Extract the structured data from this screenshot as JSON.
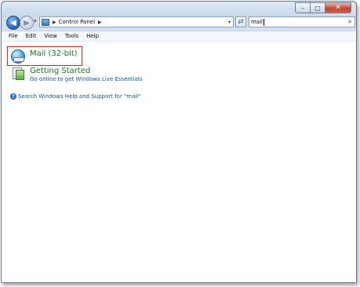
{
  "window": {
    "blurred_caption": "..."
  },
  "titlebar": {
    "minimize_glyph": "–",
    "maximize_glyph": "□",
    "close_glyph": "✕"
  },
  "navigation": {
    "back_glyph": "◀",
    "forward_glyph": "▶",
    "history_glyph": "▾",
    "breadcrumb": [
      "Control Panel"
    ],
    "crumb_separator": "▶",
    "address_dropdown_glyph": "▾",
    "refresh_glyph": "⇄"
  },
  "search": {
    "value": "mail",
    "clear_glyph": "✕"
  },
  "menubar": {
    "items": [
      "File",
      "Edit",
      "View",
      "Tools",
      "Help"
    ]
  },
  "results": [
    {
      "title": "Mail (32-bit)",
      "icon": "mail-icon",
      "highlighted": true
    },
    {
      "title": "Getting Started",
      "link": "Go online to get Windows Live Essentials",
      "icon": "getting-started-icon"
    }
  ],
  "help": {
    "icon_glyph": "?",
    "text": "Search Windows Help and Support for \"mail\""
  },
  "colors": {
    "result_title": "#1e7b24",
    "link": "#1a56b8",
    "highlight_border": "#d12a2a"
  }
}
